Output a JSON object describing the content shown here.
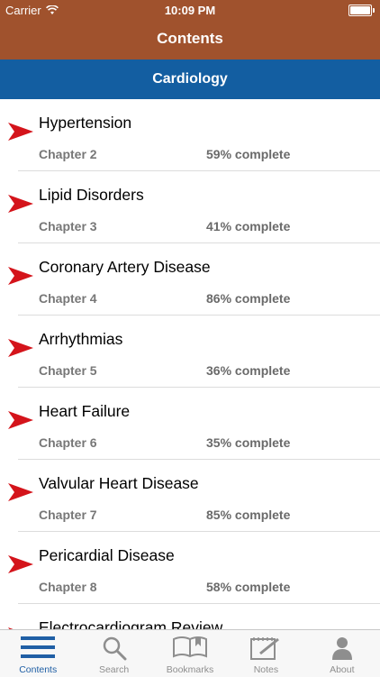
{
  "status": {
    "carrier": "Carrier",
    "time": "10:09 PM"
  },
  "nav": {
    "title": "Contents"
  },
  "section": {
    "title": "Cardiology"
  },
  "colors": {
    "nav_background": "#a0522d",
    "section_background": "#135ea1",
    "arrow": "#d4141b",
    "tab_active": "#1f5fa5",
    "tab_inactive": "#8e8e8e"
  },
  "chapters": [
    {
      "title": "Hypertension",
      "chapter": "Chapter 2",
      "progress": "59% complete"
    },
    {
      "title": "Lipid Disorders",
      "chapter": "Chapter 3",
      "progress": "41% complete"
    },
    {
      "title": "Coronary Artery Disease",
      "chapter": "Chapter 4",
      "progress": "86% complete"
    },
    {
      "title": "Arrhythmias",
      "chapter": "Chapter 5",
      "progress": "36% complete"
    },
    {
      "title": "Heart Failure",
      "chapter": "Chapter 6",
      "progress": "35% complete"
    },
    {
      "title": "Valvular Heart Disease",
      "chapter": "Chapter 7",
      "progress": "85% complete"
    },
    {
      "title": "Pericardial Disease",
      "chapter": "Chapter 8",
      "progress": "58% complete"
    },
    {
      "title": "Electrocardiogram Review",
      "chapter": "",
      "progress": ""
    }
  ],
  "tabs": [
    {
      "label": "Contents",
      "icon": "contents-list-icon",
      "active": true
    },
    {
      "label": "Search",
      "icon": "search-icon",
      "active": false
    },
    {
      "label": "Bookmarks",
      "icon": "bookmarks-book-icon",
      "active": false
    },
    {
      "label": "Notes",
      "icon": "notes-pad-icon",
      "active": false
    },
    {
      "label": "About",
      "icon": "person-icon",
      "active": false
    }
  ]
}
